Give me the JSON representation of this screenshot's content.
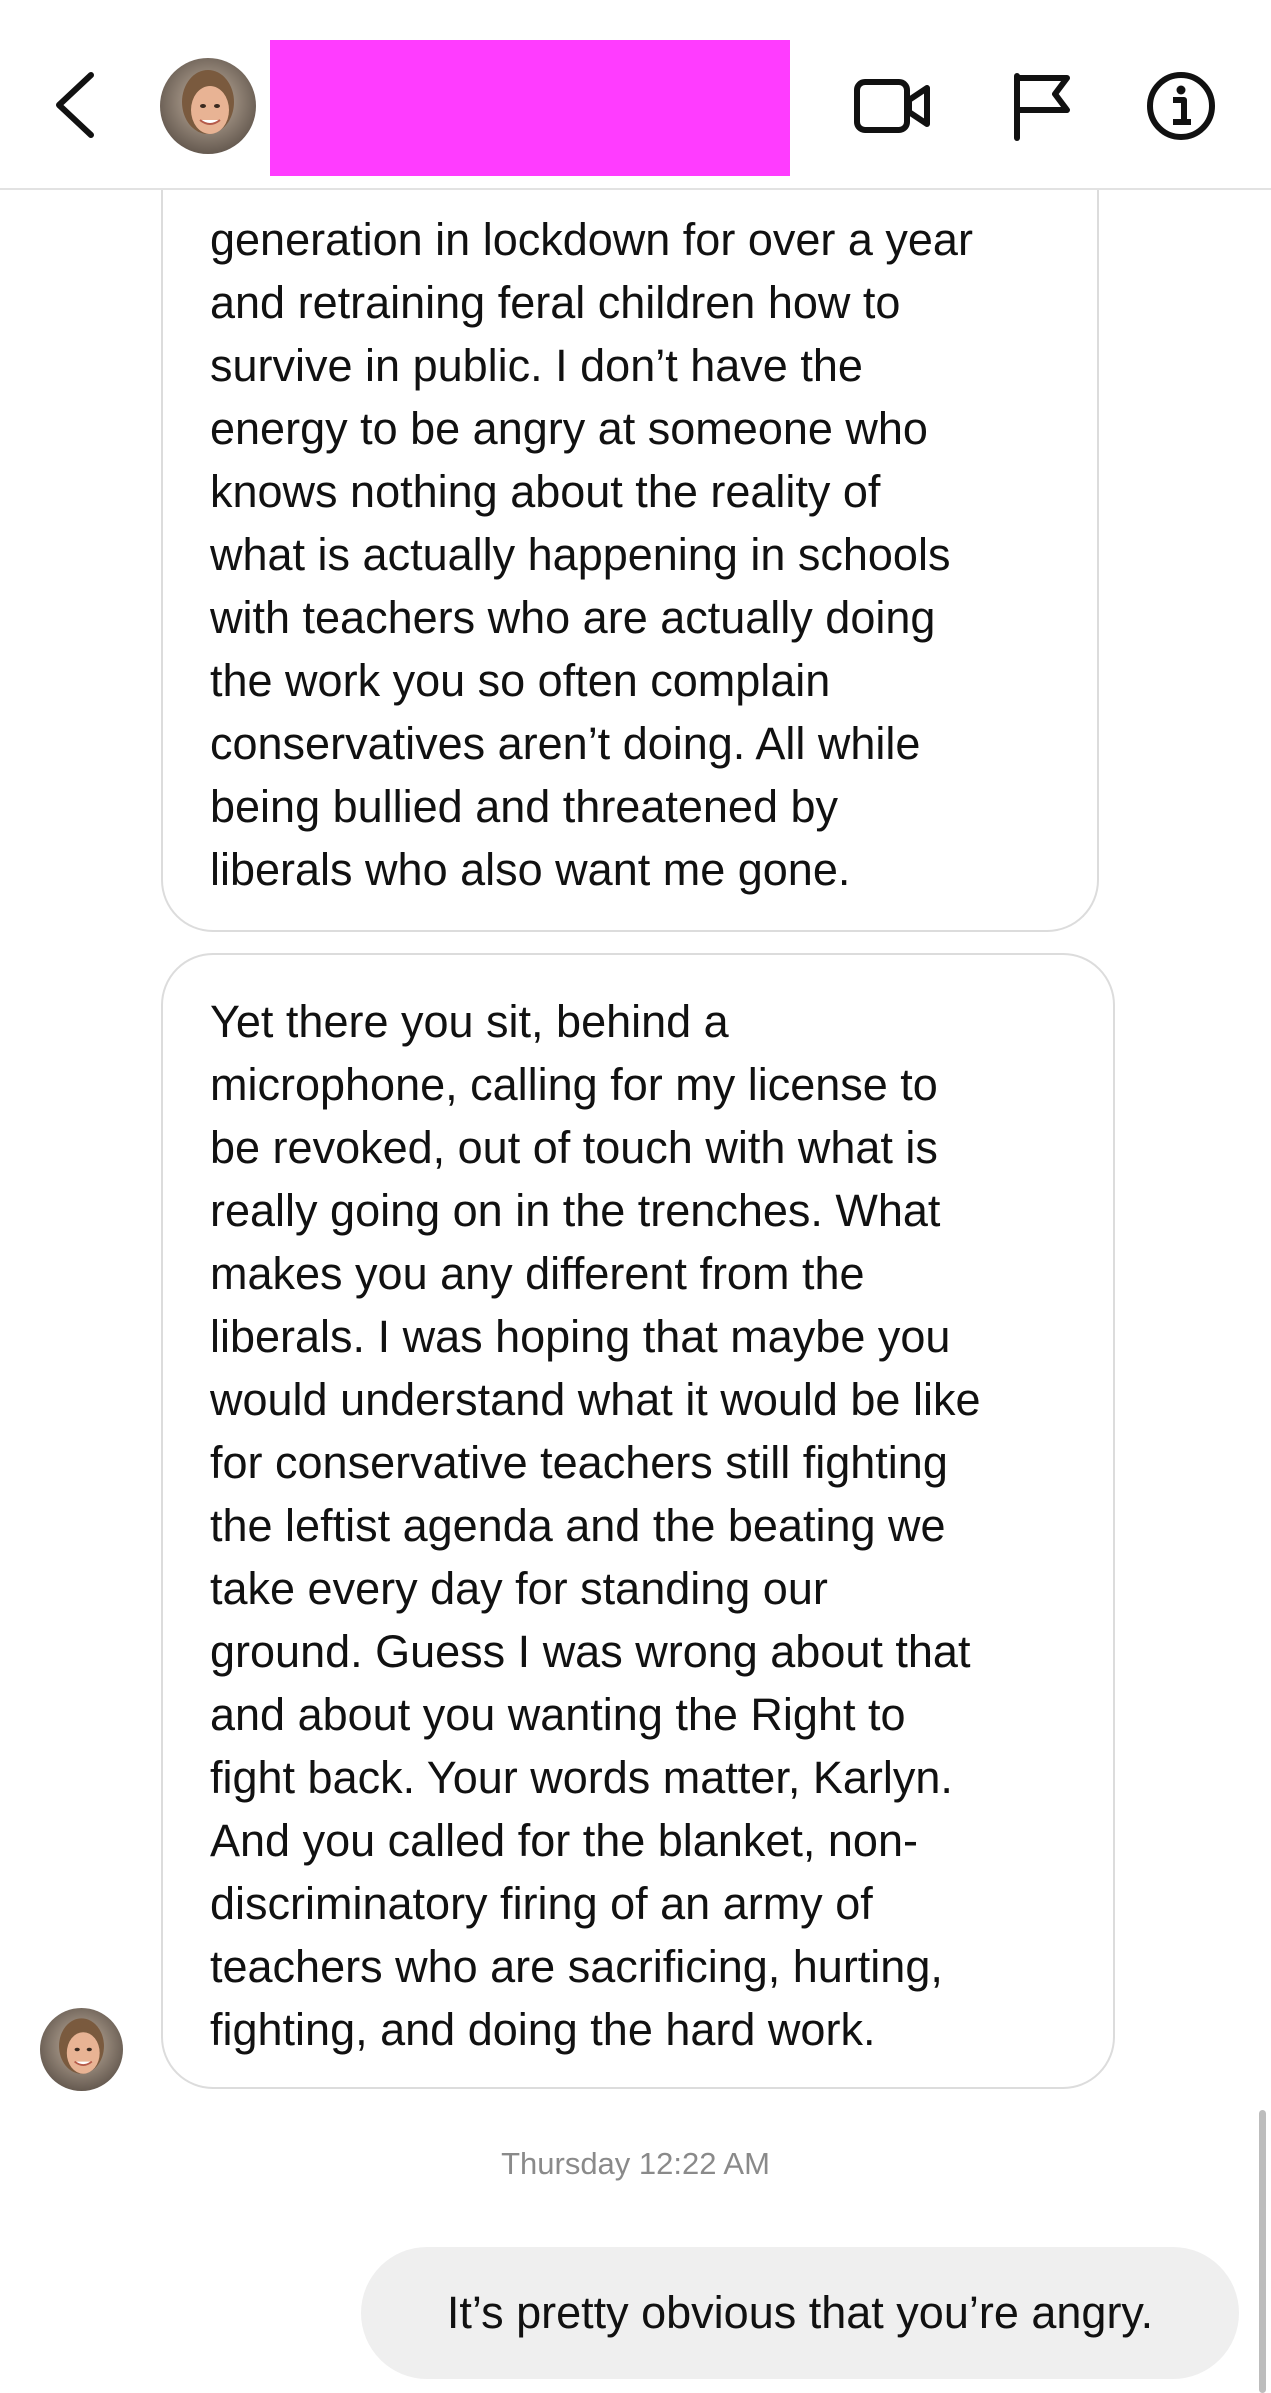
{
  "header": {
    "back_icon": "chevron-left-icon",
    "avatar_icon": "profile-photo",
    "name_redaction_color": "#ff3cff",
    "actions": [
      {
        "icon": "video-call-icon"
      },
      {
        "icon": "flag-icon"
      },
      {
        "icon": "info-icon"
      }
    ]
  },
  "messages": [
    {
      "from": "other",
      "lines": [
        "generation in lockdown for over a year",
        "and retraining feral children how to",
        "survive in public. I don’t have the",
        "energy to be angry at someone who",
        "knows nothing about the reality of",
        "what is actually happening in schools",
        "with teachers who are actually doing",
        "the work you so often complain",
        "conservatives aren’t doing. All while",
        "being bullied and threatened by",
        "liberals who also want me gone."
      ]
    },
    {
      "from": "other",
      "lines": [
        "Yet there you sit, behind a",
        "microphone, calling for my license to",
        "be revoked, out of touch with what is",
        "really going on in the trenches. What",
        "makes you any different from the",
        "liberals. I was hoping that maybe you",
        "would understand what it would be like",
        "for conservative teachers still fighting",
        "the leftist agenda and the beating we",
        "take every day for standing our",
        "ground. Guess I was wrong about that",
        "and about you wanting the Right to",
        "fight back. Your words matter, Karlyn.",
        "And you called for the blanket, non-",
        "discriminatory firing of an army of",
        "teachers who are sacrificing, hurting,",
        "fighting, and doing the hard work."
      ]
    }
  ],
  "timestamp": "Thursday 12:22 AM",
  "my_message": "It’s pretty obvious that you’re angry.",
  "colors": {
    "bubble_border": "#dcdcdc",
    "my_bubble_bg": "#efefef",
    "timestamp_text": "#8a8a8a"
  }
}
